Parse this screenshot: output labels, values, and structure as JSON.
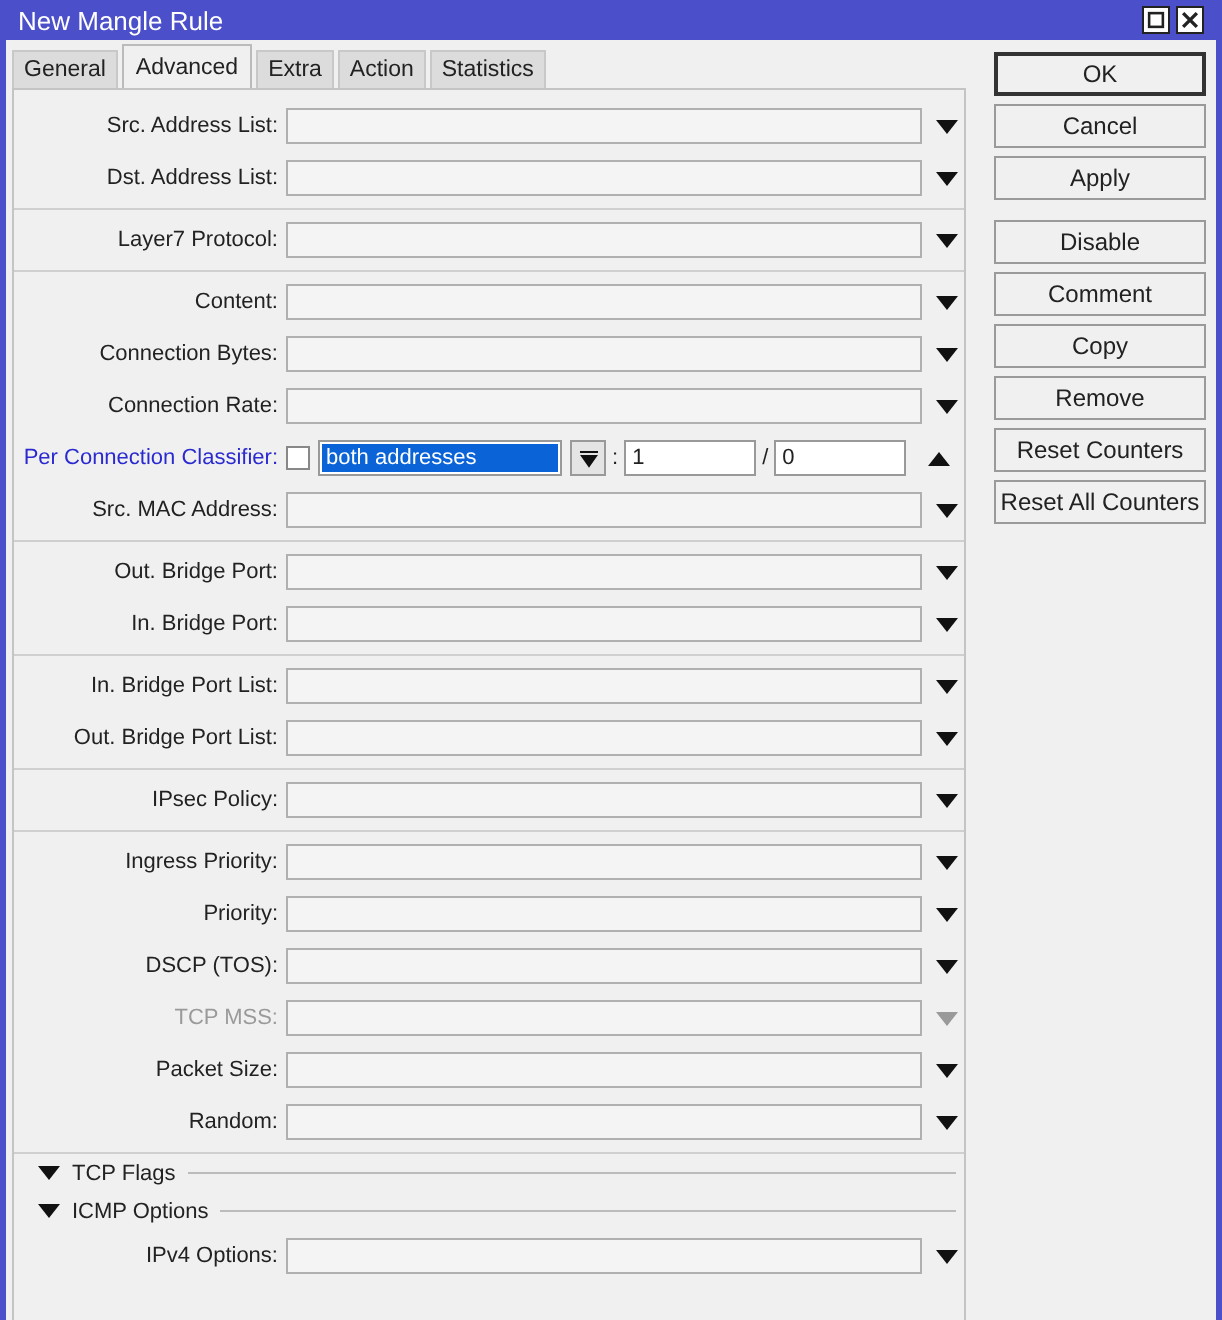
{
  "window": {
    "title": "New Mangle Rule"
  },
  "tabs": [
    {
      "label": "General",
      "selected": false
    },
    {
      "label": "Advanced",
      "selected": true
    },
    {
      "label": "Extra",
      "selected": false
    },
    {
      "label": "Action",
      "selected": false
    },
    {
      "label": "Statistics",
      "selected": false
    }
  ],
  "content": [
    {
      "kind": "group",
      "fields": [
        {
          "kind": "dropdown",
          "label": "Src. Address List:",
          "disabled": false
        },
        {
          "kind": "dropdown",
          "label": "Dst. Address List:",
          "disabled": false
        }
      ]
    },
    {
      "kind": "group",
      "fields": [
        {
          "kind": "dropdown",
          "label": "Layer7 Protocol:",
          "disabled": false
        }
      ]
    },
    {
      "kind": "group",
      "fields": [
        {
          "kind": "dropdown",
          "label": "Content:",
          "disabled": false
        },
        {
          "kind": "dropdown",
          "label": "Connection Bytes:",
          "disabled": false
        },
        {
          "kind": "dropdown",
          "label": "Connection Rate:",
          "disabled": false
        },
        {
          "kind": "classifier",
          "label": "Per Connection Classifier:",
          "checked": false,
          "mode": "both addresses",
          "mode_selected": true,
          "separator_1": ":",
          "value_1": "1",
          "separator_2": "/",
          "value_2": "0"
        },
        {
          "kind": "dropdown",
          "label": "Src. MAC Address:",
          "disabled": false
        }
      ]
    },
    {
      "kind": "group",
      "fields": [
        {
          "kind": "dropdown",
          "label": "Out. Bridge Port:",
          "disabled": false
        },
        {
          "kind": "dropdown",
          "label": "In. Bridge Port:",
          "disabled": false
        }
      ]
    },
    {
      "kind": "group",
      "fields": [
        {
          "kind": "dropdown",
          "label": "In. Bridge Port List:",
          "disabled": false
        },
        {
          "kind": "dropdown",
          "label": "Out. Bridge Port List:",
          "disabled": false
        }
      ]
    },
    {
      "kind": "group",
      "fields": [
        {
          "kind": "dropdown",
          "label": "IPsec Policy:",
          "disabled": false
        }
      ]
    },
    {
      "kind": "group",
      "fields": [
        {
          "kind": "dropdown",
          "label": "Ingress Priority:",
          "disabled": false
        },
        {
          "kind": "dropdown",
          "label": "Priority:",
          "disabled": false
        },
        {
          "kind": "dropdown",
          "label": "DSCP (TOS):",
          "disabled": false
        },
        {
          "kind": "dropdown",
          "label": "TCP MSS:",
          "disabled": true
        },
        {
          "kind": "dropdown",
          "label": "Packet Size:",
          "disabled": false
        },
        {
          "kind": "dropdown",
          "label": "Random:",
          "disabled": false
        }
      ]
    },
    {
      "kind": "section",
      "label": "TCP Flags",
      "expanded": false
    },
    {
      "kind": "section",
      "label": "ICMP Options",
      "expanded": false
    },
    {
      "kind": "plain",
      "fields": [
        {
          "kind": "dropdown",
          "label": "IPv4 Options:",
          "disabled": false
        }
      ]
    }
  ],
  "buttons": [
    {
      "label": "OK",
      "default": true
    },
    {
      "label": "Cancel",
      "default": false
    },
    {
      "label": "Apply",
      "default": false
    },
    {
      "label": "Disable",
      "default": false
    },
    {
      "label": "Comment",
      "default": false
    },
    {
      "label": "Copy",
      "default": false
    },
    {
      "label": "Remove",
      "default": false
    },
    {
      "label": "Reset Counters",
      "default": false
    },
    {
      "label": "Reset All Counters",
      "default": false
    }
  ]
}
